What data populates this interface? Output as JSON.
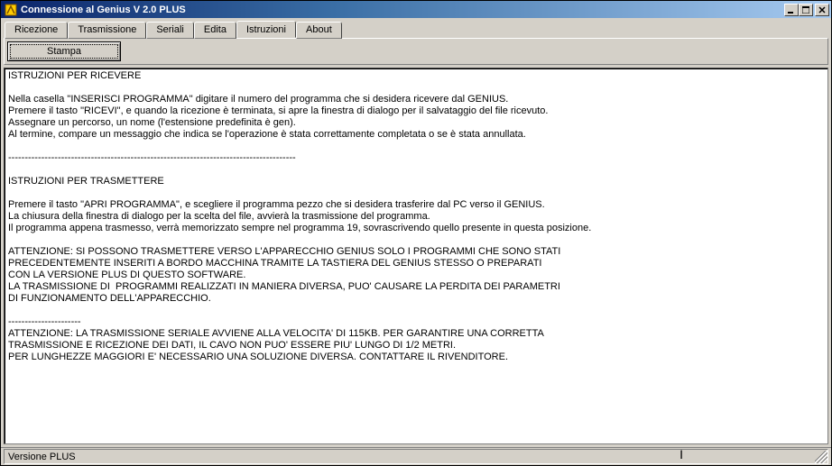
{
  "window": {
    "title": "Connessione al Genius V 2.0 PLUS"
  },
  "tabs": [
    {
      "label": "Ricezione",
      "active": false
    },
    {
      "label": "Trasmissione",
      "active": false
    },
    {
      "label": "Seriali",
      "active": false
    },
    {
      "label": "Edita",
      "active": false
    },
    {
      "label": "Istruzioni",
      "active": true
    },
    {
      "label": "About",
      "active": false
    }
  ],
  "toolbar": {
    "stampa_label": "Stampa"
  },
  "instructions_text": "ISTRUZIONI PER RICEVERE\n\nNella casella \"INSERISCI PROGRAMMA\" digitare il numero del programma che si desidera ricevere dal GENIUS.\nPremere il tasto \"RICEVI\", e quando la ricezione è terminata, si apre la finestra di dialogo per il salvataggio del file ricevuto.\nAssegnare un percorso, un nome (l'estensione predefinita è gen).\nAl termine, compare un messaggio che indica se l'operazione è stata correttamente completata o se è stata annullata.\n\n---------------------------------------------------------------------------------------\n\nISTRUZIONI PER TRASMETTERE\n\nPremere il tasto \"APRI PROGRAMMA\", e scegliere il programma pezzo che si desidera trasferire dal PC verso il GENIUS.\nLa chiusura della finestra di dialogo per la scelta del file, avvierà la trasmissione del programma.\nIl programma appena trasmesso, verrà memorizzato sempre nel programma 19, sovrascrivendo quello presente in questa posizione.\n\nATTENZIONE: SI POSSONO TRASMETTERE VERSO L'APPARECCHIO GENIUS SOLO I PROGRAMMI CHE SONO STATI\nPRECEDENTEMENTE INSERITI A BORDO MACCHINA TRAMITE LA TASTIERA DEL GENIUS STESSO O PREPARATI\nCON LA VERSIONE PLUS DI QUESTO SOFTWARE.\nLA TRASMISSIONE DI  PROGRAMMI REALIZZATI IN MANIERA DIVERSA, PUO' CAUSARE LA PERDITA DEI PARAMETRI\nDI FUNZIONAMENTO DELL'APPARECCHIO.\n\n----------------------\nATTENZIONE: LA TRASMISSIONE SERIALE AVVIENE ALLA VELOCITA' DI 115KB. PER GARANTIRE UNA CORRETTA\nTRASMISSIONE E RICEZIONE DEI DATI, IL CAVO NON PUO' ESSERE PIU' LUNGO DI 1/2 METRI.\nPER LUNGHEZZE MAGGIORI E' NECESSARIO UNA SOLUZIONE DIVERSA. CONTATTARE IL RIVENDITORE.",
  "statusbar": {
    "version_label": "Versione PLUS"
  }
}
